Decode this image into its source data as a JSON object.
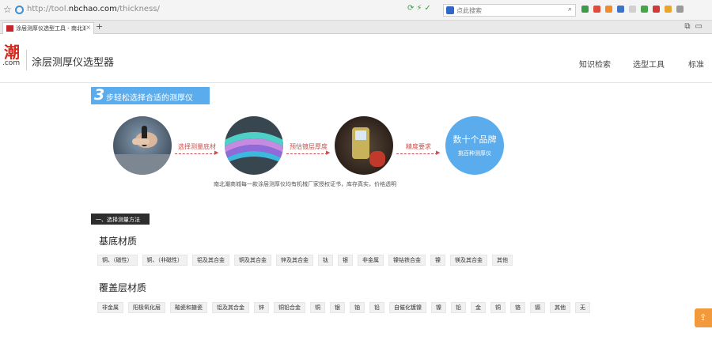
{
  "browser": {
    "url_prefix": "http://tool.",
    "url_domain": "nbchao.com",
    "url_path": "/thickness/",
    "search_placeholder": "点此搜索",
    "tab_title": "涂层测厚仪选型工具 - 南北潮",
    "tab_close": "×",
    "new_tab": "+"
  },
  "header": {
    "logo_char": "潮",
    "logo_com": ".com",
    "site_title": "涂层测厚仪选型器",
    "nav": [
      "知识检索",
      "选型工具",
      "标准"
    ]
  },
  "banner": {
    "step_num": "3",
    "step_text": "步轻松选择合适的测厚仪",
    "steps": [
      "选择测量底材",
      "预估镀层厚度",
      "精度要求"
    ],
    "brand_big": "数十个品牌",
    "brand_small": "挑百种测厚仪",
    "promise": "南北潮商城每一款涂层测厚仪均有机械厂家授权证书，库存真实，价格透明"
  },
  "method": {
    "tag": "一、选择测量方法",
    "substrate_title": "基底材质",
    "substrate": [
      "铜、（磁性）",
      "铜、（非磁性）",
      "铝及其合金",
      "铜及其合金",
      "锌及其合金",
      "钛",
      "银",
      "非金属",
      "镍钴铁合金",
      "镍",
      "镁及其合金",
      "其他"
    ],
    "coating_title": "覆盖层材质",
    "coating": [
      "非金属",
      "阳极氧化层",
      "釉瓷和搪瓷",
      "铝及其合金",
      "锌",
      "铜铅合金",
      "铜",
      "银",
      "铀",
      "铅",
      "自催化镀镍",
      "镍",
      "铅",
      "金",
      "铜",
      "铬",
      "镉",
      "其他",
      "无"
    ]
  },
  "colors": {
    "accent": "#5aacec",
    "brand_red": "#d42a1f",
    "float": "#f2993b"
  }
}
